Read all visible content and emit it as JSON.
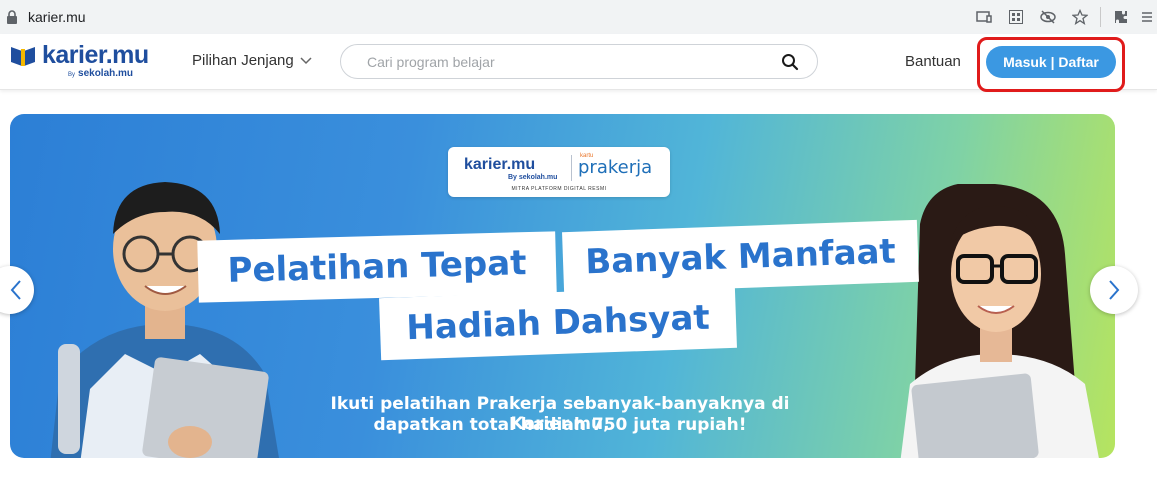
{
  "browser": {
    "url": "karier.mu"
  },
  "header": {
    "logo_text": "karier.mu",
    "logo_by": "By",
    "logo_sub": "sekolah.mu",
    "nav_pilihan": "Pilihan Jenjang",
    "search_placeholder": "Cari program belajar",
    "search_value": "",
    "bantuan": "Bantuan",
    "login_button": "Masuk | Daftar"
  },
  "banner": {
    "partner_karier": "karier.mu",
    "partner_by": "By sekolah.mu",
    "partner_kartu": "kartu",
    "partner_prakerja": "prakerja",
    "partner_mitra": "MITRA PLATFORM DIGITAL RESMI",
    "headline_1": "Pelatihan Tepat",
    "headline_2": "Banyak Manfaat",
    "headline_3": "Hadiah Dahsyat",
    "subtitle_1": "Ikuti pelatihan Prakerja sebanyak-banyaknya di Karier.mu,",
    "subtitle_2": "dapatkan total hadiah 750 juta rupiah!"
  },
  "colors": {
    "brand": "#1f4e9e",
    "button": "#3b98e2",
    "highlight": "#e01b1b"
  }
}
